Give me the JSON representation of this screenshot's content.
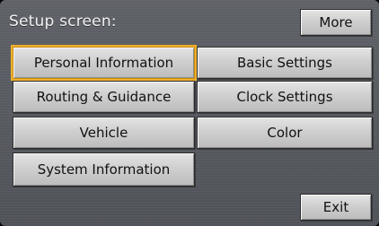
{
  "header": {
    "title": "Setup screen:"
  },
  "buttons": {
    "more": "More",
    "exit": "Exit"
  },
  "menu": {
    "personal_information": "Personal Information",
    "basic_settings": "Basic Settings",
    "routing_guidance": "Routing & Guidance",
    "clock_settings": "Clock Settings",
    "vehicle": "Vehicle",
    "color": "Color",
    "system_information": "System Information"
  },
  "colors": {
    "selection_outline": "#f0b12a",
    "background": "#56595f",
    "button_face": "#cfcfcf"
  }
}
